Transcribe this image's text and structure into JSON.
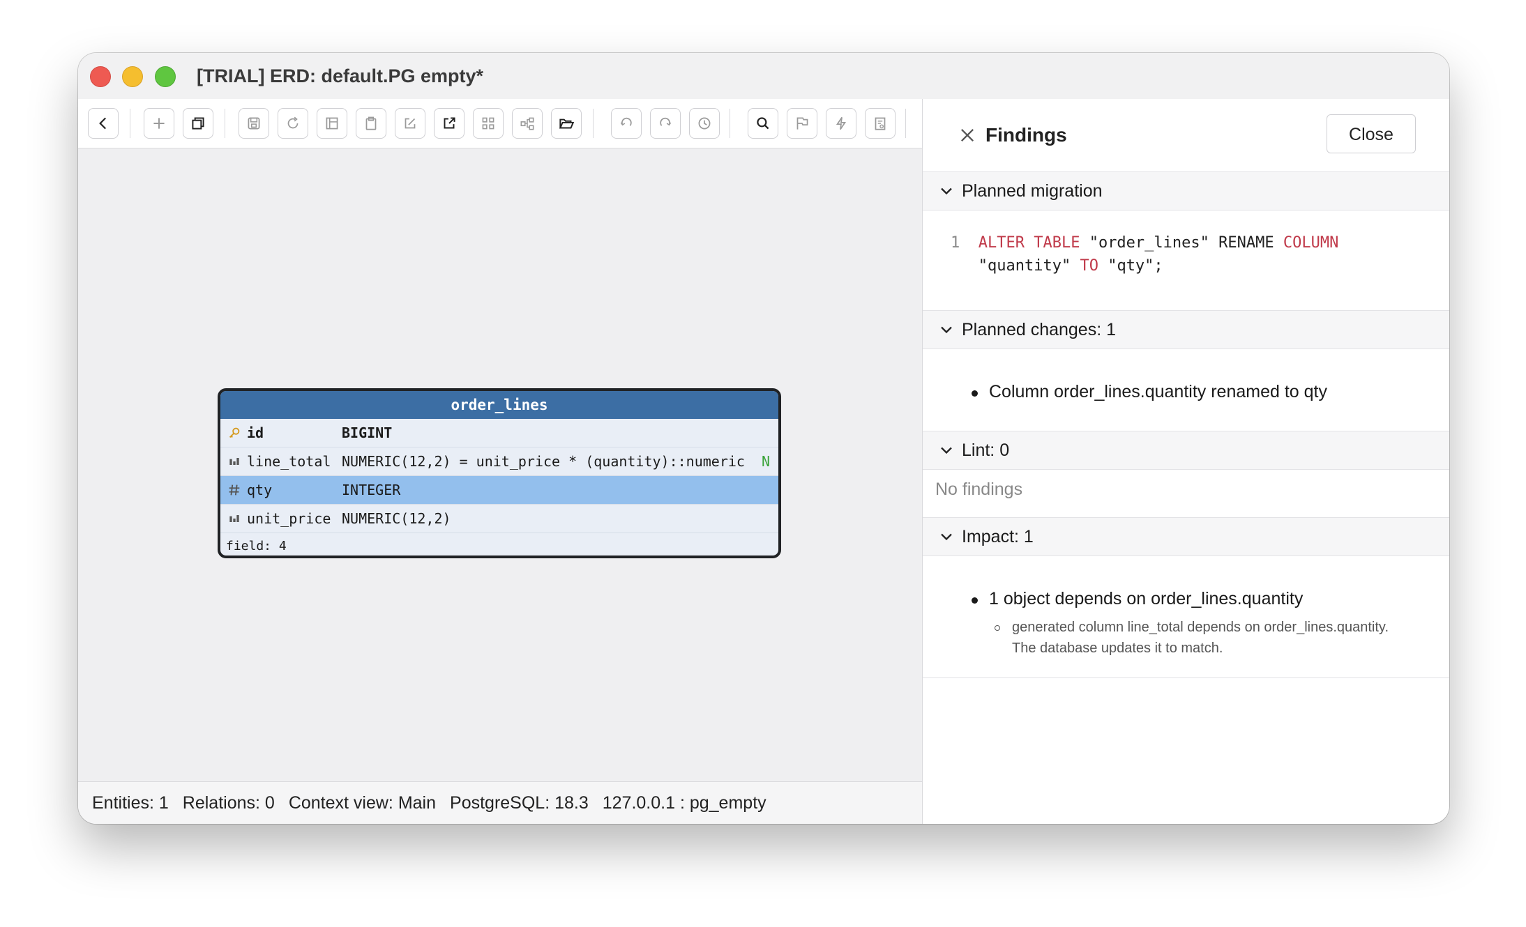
{
  "window": {
    "title": "[TRIAL] ERD: default.PG empty*"
  },
  "toolbar": {
    "buttons": [
      {
        "icon": "chevron-left-icon"
      },
      {
        "icon": "plus-icon"
      },
      {
        "icon": "copy-window-icon"
      },
      {
        "icon": "save-icon"
      },
      {
        "icon": "refresh-icon"
      },
      {
        "icon": "layout-icon"
      },
      {
        "icon": "clipboard-icon"
      },
      {
        "icon": "edit-icon"
      },
      {
        "icon": "external-link-icon"
      },
      {
        "icon": "grid-icon"
      },
      {
        "icon": "diagram-icon"
      },
      {
        "icon": "folder-open-icon"
      },
      {
        "icon": "undo-icon"
      },
      {
        "icon": "redo-icon"
      },
      {
        "icon": "history-icon"
      },
      {
        "icon": "search-icon"
      },
      {
        "icon": "flag-icon"
      },
      {
        "icon": "lightning-icon"
      },
      {
        "icon": "report-icon"
      }
    ]
  },
  "entity": {
    "name": "order_lines",
    "columns": [
      {
        "icon": "key-icon",
        "name": "id",
        "type": "BIGINT",
        "nullable": ""
      },
      {
        "icon": "column-icon",
        "name": "line_total",
        "type": "NUMERIC(12,2) = unit_price * (quantity)::numeric",
        "nullable": "N"
      },
      {
        "icon": "hash-icon",
        "name": "qty",
        "type": "INTEGER",
        "nullable": ""
      },
      {
        "icon": "column-icon",
        "name": "unit_price",
        "type": "NUMERIC(12,2)",
        "nullable": ""
      }
    ],
    "footer": "field: 4"
  },
  "status": {
    "entities": "Entities: 1",
    "relations": "Relations: 0",
    "context": "Context view: Main",
    "db": "PostgreSQL: 18.3",
    "conn": "127.0.0.1 : pg_empty"
  },
  "findings": {
    "title": "Findings",
    "close_label": "Close",
    "planned_migration": {
      "header": "Planned migration",
      "line_no": "1",
      "kw1": "ALTER TABLE",
      "t1": " \"order_lines\" RENAME ",
      "kw2": "COLUMN",
      "t2": "\"quantity\" ",
      "kw3": "TO",
      "t3": " \"qty\";"
    },
    "planned_changes": {
      "header": "Planned changes: 1",
      "items": [
        "Column order_lines.quantity renamed to qty"
      ]
    },
    "lint": {
      "header": "Lint: 0",
      "empty": "No findings"
    },
    "impact": {
      "header": "Impact: 1",
      "item": "1 object depends on order_lines.quantity",
      "sub_line1": "generated column line_total depends on order_lines.quantity.",
      "sub_line2": "The database updates it to match."
    }
  }
}
